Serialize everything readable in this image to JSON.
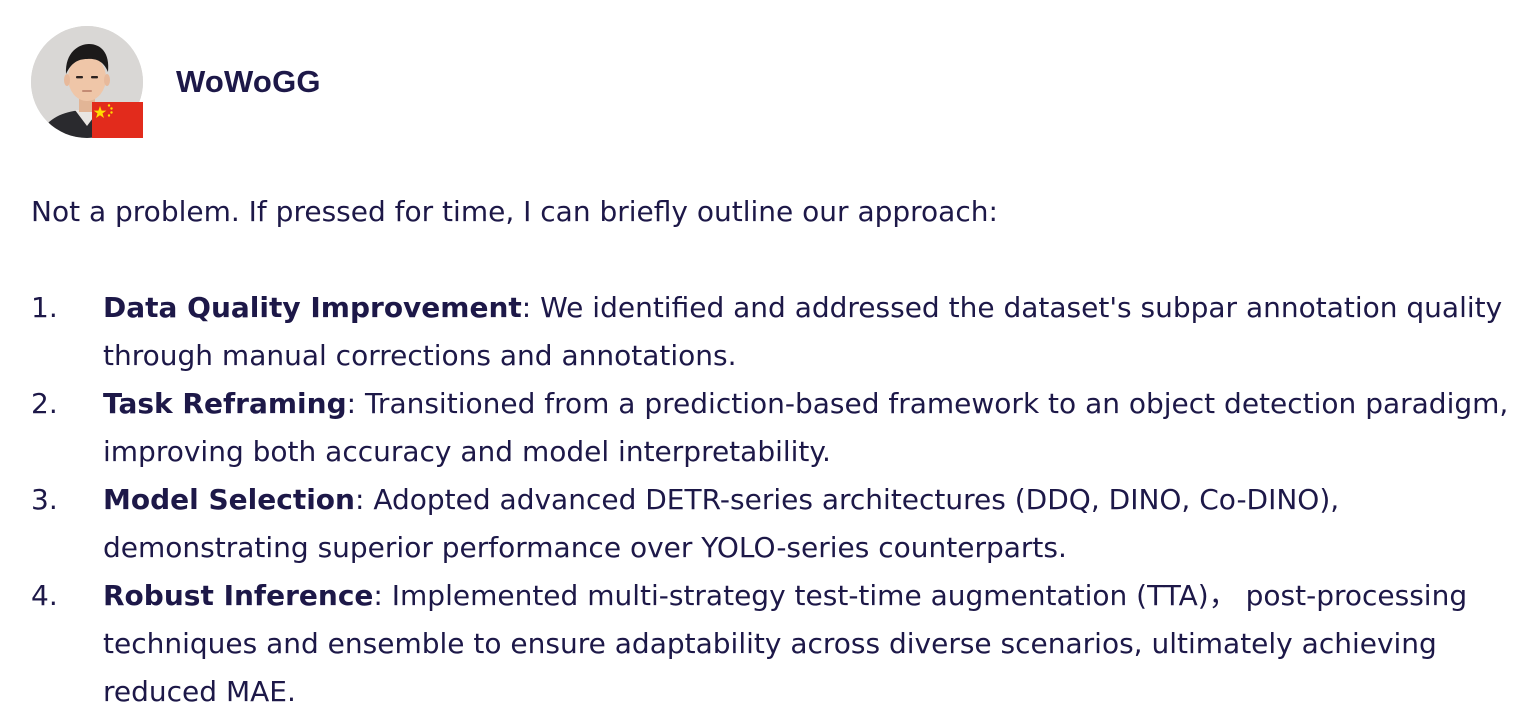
{
  "author": {
    "name": "WoWoGG",
    "avatar_icon": "user-avatar-photo",
    "flag_icon": "china-flag-icon",
    "flag_color": "#e22b1c",
    "flag_star_color": "#ffde00"
  },
  "message": {
    "intro": "Not a problem. If pressed for time, I can briefly outline our approach:",
    "items": [
      {
        "number": "1.",
        "title": "Data Quality Improvement",
        "text": ": We identified and addressed the dataset's subpar annotation quality through manual corrections and annotations."
      },
      {
        "number": "2.",
        "title": "Task Reframing",
        "text": ": Transitioned from a prediction-based framework to an object detection paradigm, improving both accuracy and model interpretability."
      },
      {
        "number": "3.",
        "title": "Model Selection",
        "text": ": Adopted advanced DETR-series architectures (DDQ, DINO, Co-DINO), demonstrating superior performance over YOLO-series counterparts."
      },
      {
        "number": "4.",
        "title": "Robust Inference",
        "text": ": Implemented multi-strategy test-time augmentation (TTA)， post-processing techniques and ensemble to ensure adaptability across diverse scenarios, ultimately achieving reduced MAE."
      }
    ]
  },
  "colors": {
    "text": "#1d1848",
    "background": "#ffffff"
  }
}
